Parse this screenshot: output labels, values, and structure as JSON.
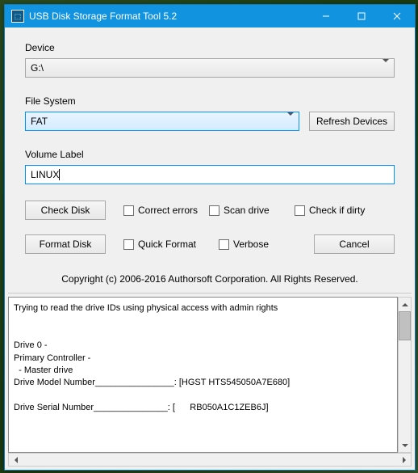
{
  "titlebar": {
    "title": "USB Disk Storage Format Tool 5.2"
  },
  "labels": {
    "device": "Device",
    "filesystem": "File System",
    "volume_label": "Volume Label"
  },
  "fields": {
    "device_value": "G:\\",
    "filesystem_value": "FAT",
    "volume_label_value": "LINUX"
  },
  "buttons": {
    "refresh": "Refresh Devices",
    "check_disk": "Check Disk",
    "format_disk": "Format Disk",
    "cancel": "Cancel"
  },
  "checkboxes": {
    "correct_errors": "Correct errors",
    "scan_drive": "Scan drive",
    "check_dirty": "Check if dirty",
    "quick_format": "Quick Format",
    "verbose": "Verbose"
  },
  "copyright": "Copyright (c) 2006-2016 Authorsoft Corporation. All Rights Reserved.",
  "log": "Trying to read the drive IDs using physical access with admin rights\n\n\nDrive 0 - \nPrimary Controller - \n  - Master drive\nDrive Model Number________________: [HGST HTS545050A7E680]\n\nDrive Serial Number_______________: [      RB050A1C1ZEB6J]\n"
}
